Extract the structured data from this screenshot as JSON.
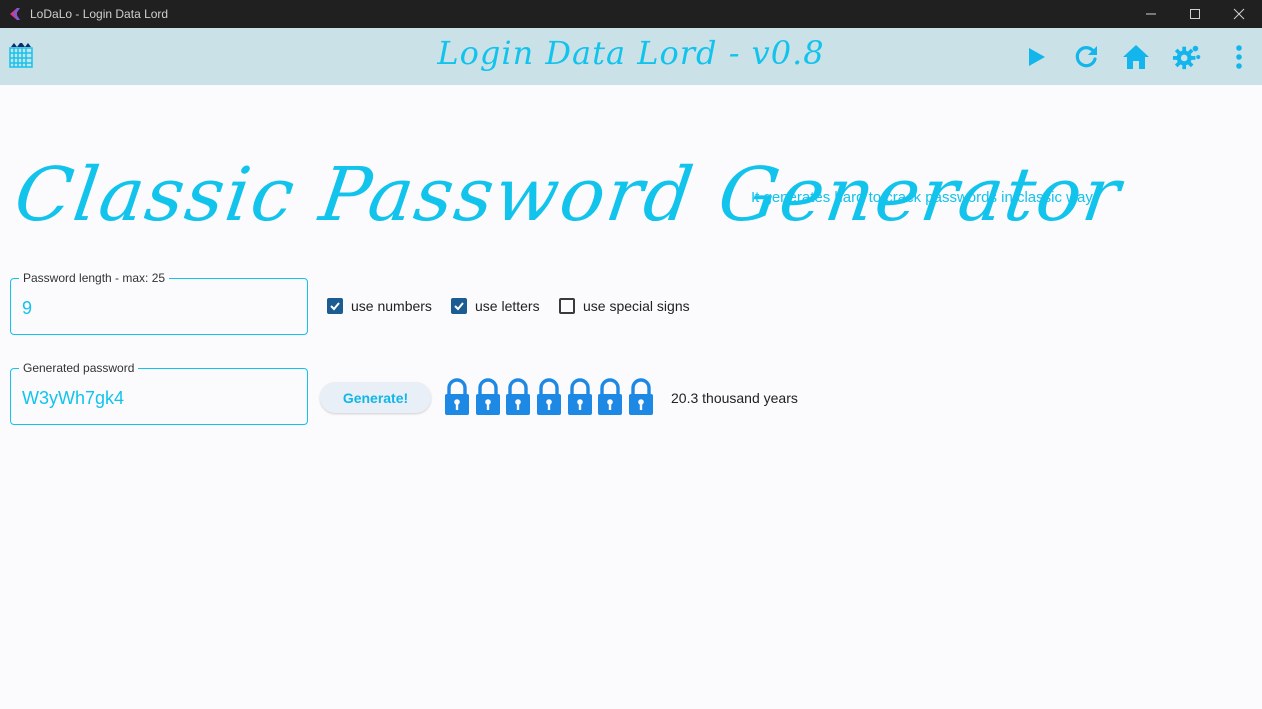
{
  "window": {
    "title": "LoDaLo - Login Data Lord",
    "controls": [
      "minimize-icon",
      "maximize-icon",
      "close-icon"
    ]
  },
  "appbar": {
    "logo_icon": "portcullis-icon",
    "title": "Login Data Lord - v0.8",
    "actions": [
      "play-icon",
      "refresh-icon",
      "home-icon",
      "settings-icon",
      "more-vert-icon"
    ],
    "background": "#cbe1e8",
    "accent": "#12c3ec"
  },
  "page": {
    "title": "Classic Password Generator",
    "subtitle": "It generates hard to crack passwords in classic way"
  },
  "length_field": {
    "label": "Password length - max: 25",
    "value": "9"
  },
  "options": {
    "numbers": {
      "label": "use numbers",
      "checked": true
    },
    "letters": {
      "label": "use letters",
      "checked": true
    },
    "special": {
      "label": "use special signs",
      "checked": false
    }
  },
  "password_field": {
    "label": "Generated password",
    "value": "W3yWh7gk4"
  },
  "generate_button": {
    "label": "Generate!"
  },
  "strength": {
    "lock_count": 7,
    "lock_icon": "lock-icon",
    "lock_color": "#1e88e5",
    "crack_time": "20.3 thousand years"
  }
}
